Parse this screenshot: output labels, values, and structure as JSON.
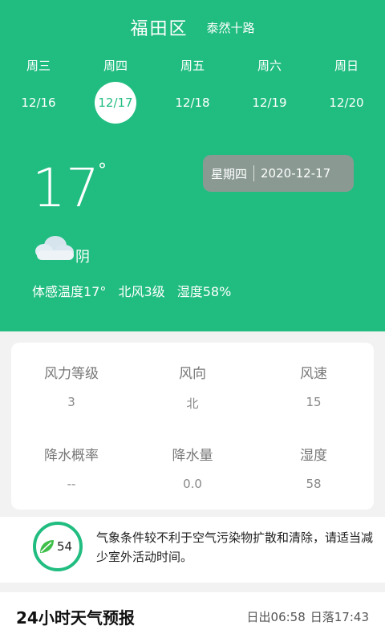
{
  "location": {
    "district": "福田区",
    "street": "泰然十路"
  },
  "days": [
    {
      "weekday": "周三",
      "date": "12/16",
      "selected": false
    },
    {
      "weekday": "周四",
      "date": "12/17",
      "selected": true
    },
    {
      "weekday": "周五",
      "date": "12/18",
      "selected": false
    },
    {
      "weekday": "周六",
      "date": "12/19",
      "selected": false
    },
    {
      "weekday": "周日",
      "date": "12/20",
      "selected": false
    }
  ],
  "current": {
    "temperature": "17",
    "degree_symbol": "°",
    "condition": "阴",
    "condition_icon": "cloud-icon",
    "weekday": "星期四",
    "full_date": "2020-12-17",
    "feels_like": "体感温度17°",
    "wind": "北风3级",
    "humidity": "湿度58%"
  },
  "details": [
    {
      "label": "风力等级",
      "value": "3"
    },
    {
      "label": "风向",
      "value": "北"
    },
    {
      "label": "风速",
      "value": "15"
    },
    {
      "label": "降水概率",
      "value": "--"
    },
    {
      "label": "降水量",
      "value": "0.0"
    },
    {
      "label": "湿度",
      "value": "58"
    }
  ],
  "air": {
    "aqi": "54",
    "icon": "leaf-icon",
    "tip": "气象条件较不利于空气污染物扩散和清除，请适当减少室外活动时间。"
  },
  "forecast": {
    "title": "24小时天气预报",
    "sunrise": "日出06:58",
    "sunset": "日落17:43"
  },
  "colors": {
    "accent": "#21bd80",
    "date_badge": "#8a9a93"
  }
}
